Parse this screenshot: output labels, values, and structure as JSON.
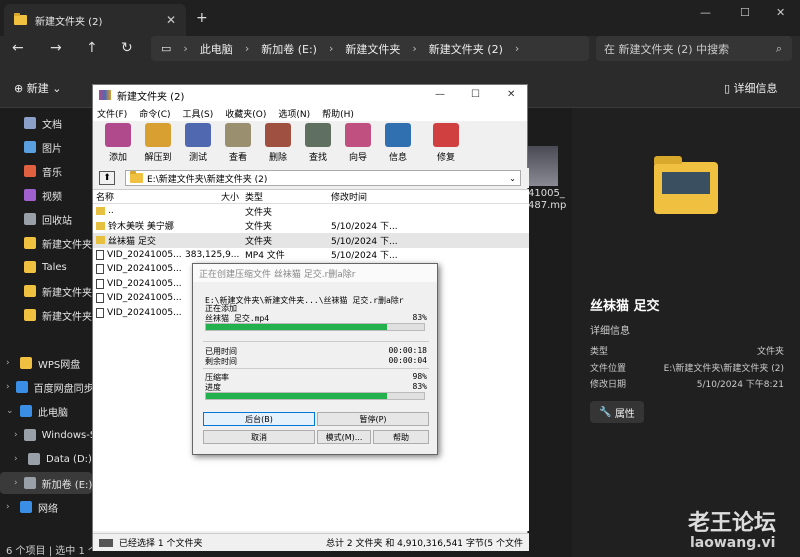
{
  "explorer": {
    "tab_title": "新建文件夹 (2)",
    "nav": {
      "back": "←",
      "forward": "→",
      "up": "↑",
      "refresh": "↻"
    },
    "breadcrumb": [
      "此电脑",
      "新加卷 (E:)",
      "新建文件夹",
      "新建文件夹 (2)"
    ],
    "search_placeholder": "在 新建文件夹 (2) 中搜索",
    "cmd_new": "新建",
    "cmd_details": "详细信息",
    "sidebar": [
      {
        "label": "文档",
        "icon": "documents-icon",
        "color": "#8aa0c8"
      },
      {
        "label": "图片",
        "icon": "pictures-icon",
        "color": "#5aa0e0"
      },
      {
        "label": "音乐",
        "icon": "music-icon",
        "color": "#e06040"
      },
      {
        "label": "视频",
        "icon": "videos-icon",
        "color": "#a060d0"
      },
      {
        "label": "回收站",
        "icon": "recycle-bin-icon",
        "color": "#9aa0a8"
      },
      {
        "label": "新建文件夹",
        "icon": "folder-icon",
        "color": "#f0c040"
      },
      {
        "label": "Tales",
        "icon": "folder-icon",
        "color": "#f0c040"
      },
      {
        "label": "新建文件夹",
        "icon": "folder-icon",
        "color": "#f0c040"
      },
      {
        "label": "新建文件夹 (2)",
        "icon": "folder-icon",
        "color": "#f0c040"
      },
      {
        "label": "WPS网盘",
        "icon": "wps-cloud-icon",
        "color": "#f0c040"
      },
      {
        "label": "百度网盘同步空间",
        "icon": "baidu-cloud-icon",
        "color": "#3a8ee6"
      },
      {
        "label": "此电脑",
        "icon": "this-pc-icon",
        "color": "#3a8ee6"
      },
      {
        "label": "Windows-SSD (C:)",
        "icon": "drive-icon",
        "color": "#9aa0a8"
      },
      {
        "label": "Data (D:)",
        "icon": "drive-icon",
        "color": "#9aa0a8"
      },
      {
        "label": "新加卷 (E:)",
        "icon": "drive-icon",
        "color": "#9aa0a8"
      },
      {
        "label": "网络",
        "icon": "network-icon",
        "color": "#3a8ee6"
      }
    ],
    "status": "6 个项目  |  选中 1 个项目",
    "thumb_label": "41005_\n487.mp",
    "details": {
      "title": "丝袜猫 足交",
      "section": "详细信息",
      "rows": [
        {
          "k": "类型",
          "v": "文件夹"
        },
        {
          "k": "文件位置",
          "v": "E:\\新建文件夹\\新建文件夹 (2)"
        },
        {
          "k": "修改日期",
          "v": "5/10/2024 下午8:21"
        }
      ],
      "prop_button": "属性"
    },
    "watermark": "老王论坛",
    "watermark_url": "laowang.vi"
  },
  "winrar": {
    "title": "新建文件夹 (2)",
    "menu": [
      "文件(F)",
      "命令(C)",
      "工具(S)",
      "收藏夹(O)",
      "选项(N)",
      "帮助(H)"
    ],
    "tools": [
      {
        "label": "添加",
        "icon": "add-icon",
        "color": "#b04a8c"
      },
      {
        "label": "解压到",
        "icon": "extract-icon",
        "color": "#d8a030"
      },
      {
        "label": "测试",
        "icon": "test-icon",
        "color": "#5068b0"
      },
      {
        "label": "查看",
        "icon": "view-icon",
        "color": "#9a9070"
      },
      {
        "label": "删除",
        "icon": "delete-icon",
        "color": "#a05040"
      },
      {
        "label": "查找",
        "icon": "find-icon",
        "color": "#607060"
      },
      {
        "label": "向导",
        "icon": "wizard-icon",
        "color": "#c05080"
      },
      {
        "label": "信息",
        "icon": "info-icon",
        "color": "#3070b0"
      },
      {
        "label": "修复",
        "icon": "repair-icon",
        "color": "#d04040"
      }
    ],
    "path": "E:\\新建文件夹\\新建文件夹 (2)",
    "columns": [
      "名称",
      "大小",
      "类型",
      "修改时间"
    ],
    "rows": [
      {
        "name": "..",
        "size": "",
        "type": "文件夹",
        "date": "",
        "kind": "folder"
      },
      {
        "name": "铃木美咲 美宁娜",
        "size": "",
        "type": "文件夹",
        "date": "5/10/2024 下...",
        "kind": "folder"
      },
      {
        "name": "丝袜猫 足交",
        "size": "",
        "type": "文件夹",
        "date": "5/10/2024 下...",
        "kind": "folder"
      },
      {
        "name": "VID_20241005...",
        "size": "383,125,9...",
        "type": "MP4 文件",
        "date": "5/10/2024 下...",
        "kind": "video"
      },
      {
        "name": "VID_20241005...",
        "size": "1",
        "type": "",
        "date": "",
        "kind": "video"
      },
      {
        "name": "VID_20241005...",
        "size": "7",
        "type": "",
        "date": "",
        "kind": "video"
      },
      {
        "name": "VID_20241005...",
        "size": "1",
        "type": "",
        "date": "",
        "kind": "video"
      },
      {
        "name": "VID_20241005...",
        "size": "1",
        "type": "",
        "date": "",
        "kind": "video"
      }
    ],
    "status_left": "已经选择 1 个文件夹",
    "status_right": "总计 2 文件夹 和 4,910,316,541 字节(5 个文件"
  },
  "progress": {
    "title": "正在创建压缩文件 丝袜猫 足交.r删a除r",
    "line1": "E:\\新建文件夹\\新建文件夹...\\丝袜猫 足交.r删a除r",
    "line2": "正在添加",
    "file": "丝袜猫 足交.mp4",
    "file_pct_label": "83%",
    "file_pct": 83,
    "elapsed_label": "已用时间",
    "elapsed": "00:00:18",
    "remaining_label": "剩余时间",
    "remaining": "00:00:04",
    "ratio_label": "压缩率",
    "ratio": "98%",
    "progress_label": "进度",
    "total_pct_label": "83%",
    "total_pct": 83,
    "buttons": [
      "后台(B)",
      "暂停(P)",
      "取消",
      "模式(M)...",
      "帮助"
    ]
  }
}
